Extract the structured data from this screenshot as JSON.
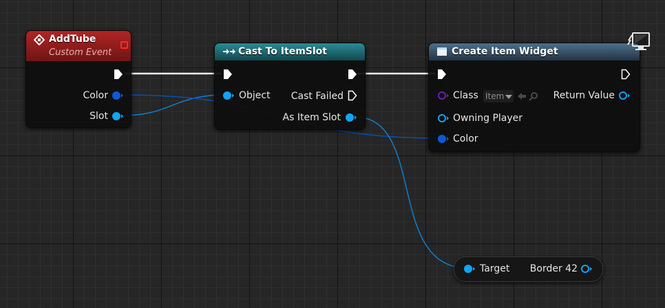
{
  "colors": {
    "exec_wire": "#f2f2f2",
    "struct_pin": "#0a5ad8",
    "object_pin": "#14a3f5",
    "class_pin": "#6a1fb5",
    "event_header": "#a51f1f",
    "cast_header": "#1d6b72",
    "function_header": "#36536a"
  },
  "nodes": {
    "add_tube": {
      "title": "AddTube",
      "subtitle": "Custom Event",
      "pins": {
        "color": "Color",
        "slot": "Slot"
      }
    },
    "cast_node": {
      "title": "Cast To ItemSlot",
      "pins": {
        "object": "Object",
        "cast_failed": "Cast Failed",
        "as_item_slot": "As Item Slot"
      }
    },
    "create_widget": {
      "title": "Create Item Widget",
      "pins": {
        "class": "Class",
        "class_value": "Item",
        "return_value": "Return Value",
        "owning_player": "Owning Player",
        "color": "Color"
      }
    },
    "target_node": {
      "pins": {
        "target": "Target",
        "output": "Border 42"
      }
    }
  }
}
